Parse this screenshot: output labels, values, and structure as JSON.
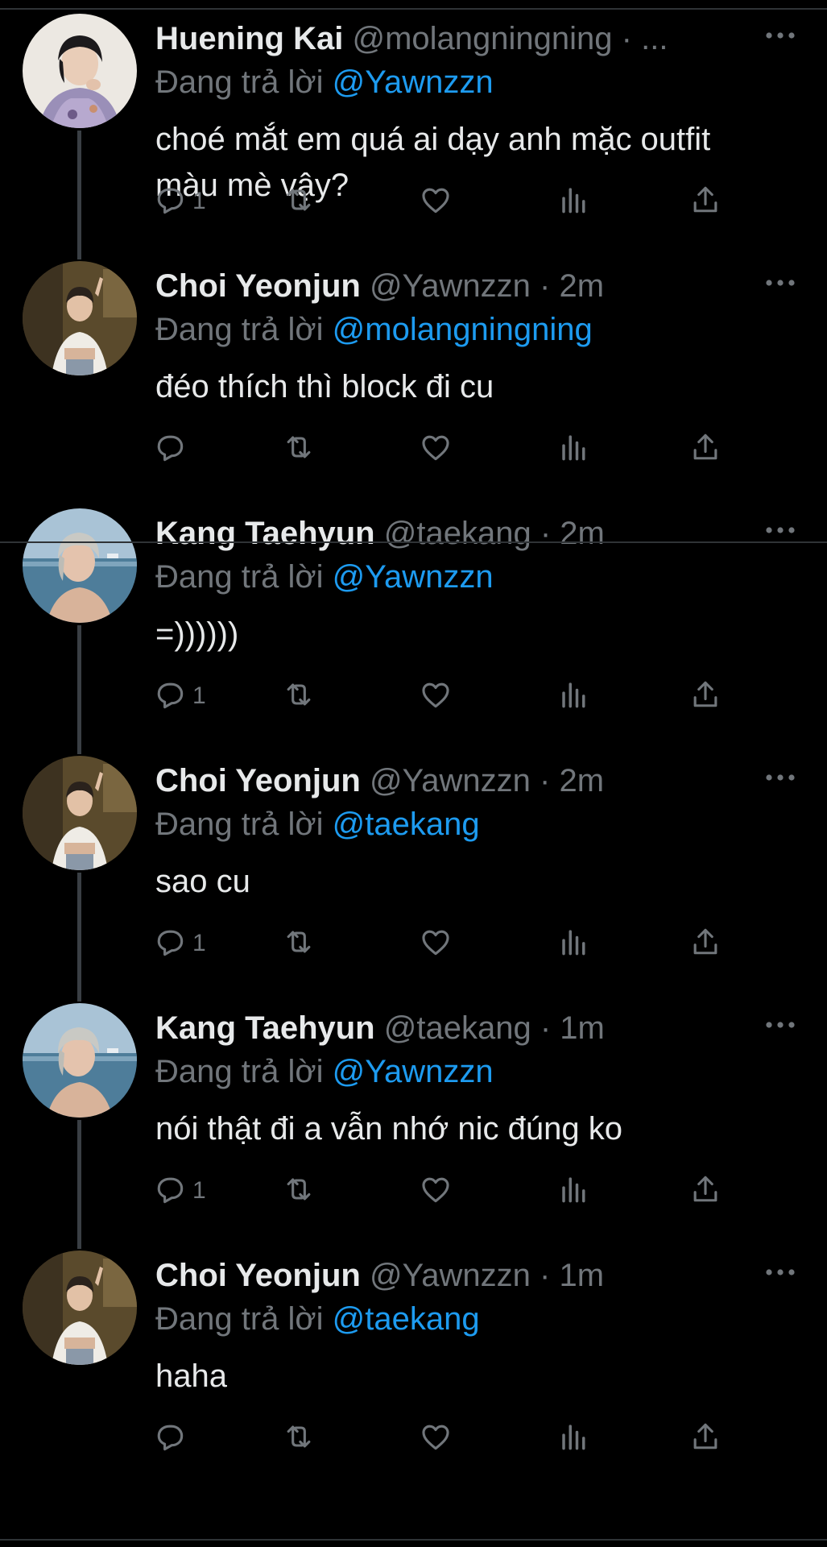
{
  "colors": {
    "background": "#000000",
    "primary_text": "#e7e9ea",
    "secondary_text": "#71767b",
    "mention": "#1d9bf0",
    "thread_line": "#3a3f44"
  },
  "reply_prefix": "Đang trả lời",
  "tweets": [
    {
      "name": "Huening Kai",
      "handle": "@molangningning",
      "sep": "·",
      "time": "...",
      "replying_to": "@Yawnzzn",
      "text": "choé mắt em quá ai dạy anh mặc outfit màu mè vậy?",
      "reply_count": "1",
      "avatar": "kai"
    },
    {
      "name": "Choi Yeonjun",
      "handle": "@Yawnzzn",
      "sep": "·",
      "time": "2m",
      "replying_to": "@molangningning",
      "text": "đéo thích thì block đi cu",
      "reply_count": "",
      "avatar": "yeonjun"
    },
    {
      "name": "Kang Taehyun",
      "handle": "@taekang",
      "sep": "·",
      "time": "2m",
      "replying_to": "@Yawnzzn",
      "text": "=))))))",
      "reply_count": "1",
      "avatar": "taehyun"
    },
    {
      "name": "Choi Yeonjun",
      "handle": "@Yawnzzn",
      "sep": "·",
      "time": "2m",
      "replying_to": "@taekang",
      "text": "sao cu",
      "reply_count": "1",
      "avatar": "yeonjun"
    },
    {
      "name": "Kang Taehyun",
      "handle": "@taekang",
      "sep": "·",
      "time": "1m",
      "replying_to": "@Yawnzzn",
      "text": "nói thật đi a vẫn nhớ nic đúng ko",
      "reply_count": "1",
      "avatar": "taehyun"
    },
    {
      "name": "Choi Yeonjun",
      "handle": "@Yawnzzn",
      "sep": "·",
      "time": "1m",
      "replying_to": "@taekang",
      "text": "haha",
      "reply_count": "",
      "avatar": "yeonjun"
    }
  ],
  "icons": [
    "reply-icon",
    "retweet-icon",
    "like-icon",
    "views-icon",
    "share-icon",
    "more-icon"
  ]
}
